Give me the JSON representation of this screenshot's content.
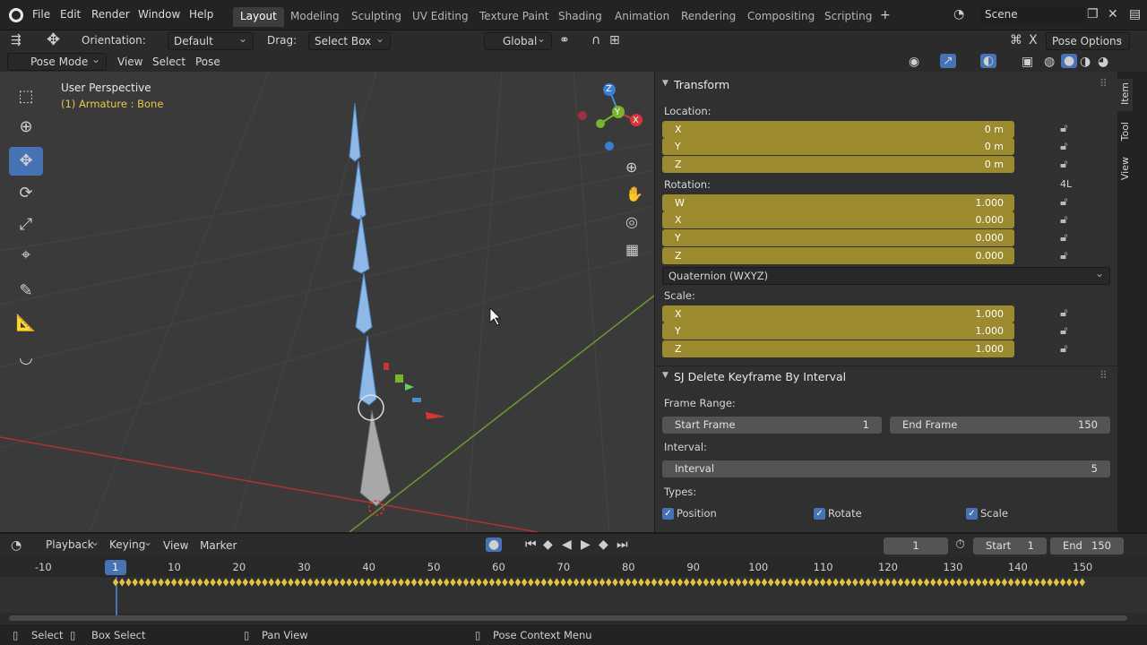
{
  "menu": {
    "file": "File",
    "edit": "Edit",
    "render": "Render",
    "window": "Window",
    "help": "Help"
  },
  "workspaces": [
    "Layout",
    "Modeling",
    "Sculpting",
    "UV Editing",
    "Texture Paint",
    "Shading",
    "Animation",
    "Rendering",
    "Compositing",
    "Scripting"
  ],
  "active_workspace": "Layout",
  "scene": "Scene",
  "header": {
    "orientation_label": "Orientation:",
    "orientation_value": "Default",
    "drag_label": "Drag:",
    "drag_value": "Select Box",
    "transform_orient": "Global",
    "pose_options": "Pose Options"
  },
  "header2": {
    "mode": "Pose Mode",
    "view": "View",
    "select": "Select",
    "pose": "Pose"
  },
  "viewport": {
    "perspective": "User Perspective",
    "active": "(1) Armature : Bone",
    "gizmo_z": "Z",
    "gizmo_y": "Y",
    "gizmo_x": "X"
  },
  "transform": {
    "title": "Transform",
    "location_label": "Location:",
    "location": [
      {
        "k": "X",
        "v": "0 m"
      },
      {
        "k": "Y",
        "v": "0 m"
      },
      {
        "k": "Z",
        "v": "0 m"
      }
    ],
    "rotation_label": "Rotation:",
    "rotation_mode_lock": "4L",
    "rotation": [
      {
        "k": "W",
        "v": "1.000"
      },
      {
        "k": "X",
        "v": "0.000"
      },
      {
        "k": "Y",
        "v": "0.000"
      },
      {
        "k": "Z",
        "v": "0.000"
      }
    ],
    "rotation_mode": "Quaternion (WXYZ)",
    "scale_label": "Scale:",
    "scale": [
      {
        "k": "X",
        "v": "1.000"
      },
      {
        "k": "Y",
        "v": "1.000"
      },
      {
        "k": "Z",
        "v": "1.000"
      }
    ]
  },
  "sj_panel": {
    "title": "SJ Delete Keyframe By Interval",
    "frame_range_label": "Frame Range:",
    "start_label": "Start Frame",
    "start_value": "1",
    "end_label": "End Frame",
    "end_value": "150",
    "interval_section": "Interval:",
    "interval_label": "Interval",
    "interval_value": "5",
    "types_label": "Types:",
    "position": "Position",
    "rotate": "Rotate",
    "scale": "Scale"
  },
  "side_tabs": {
    "item": "Item",
    "tool": "Tool",
    "view": "View"
  },
  "timeline": {
    "playback": "Playback",
    "keying": "Keying",
    "view": "View",
    "marker": "Marker",
    "current_frame": "1",
    "start_label": "Start",
    "start": "1",
    "end_label": "End",
    "end": "150",
    "ticks": [
      "-10",
      "1",
      "10",
      "20",
      "30",
      "40",
      "50",
      "60",
      "70",
      "80",
      "90",
      "100",
      "110",
      "120",
      "130",
      "140",
      "150"
    ]
  },
  "status": {
    "select": "Select",
    "box_select": "Box Select",
    "pan_view": "Pan View",
    "context_menu": "Pose Context Menu"
  },
  "colors": {
    "accent": "#4772b3",
    "field_yellow": "#9c8a2f",
    "bone_blue": "#6aa6de",
    "keyframe": "#e0c341"
  }
}
